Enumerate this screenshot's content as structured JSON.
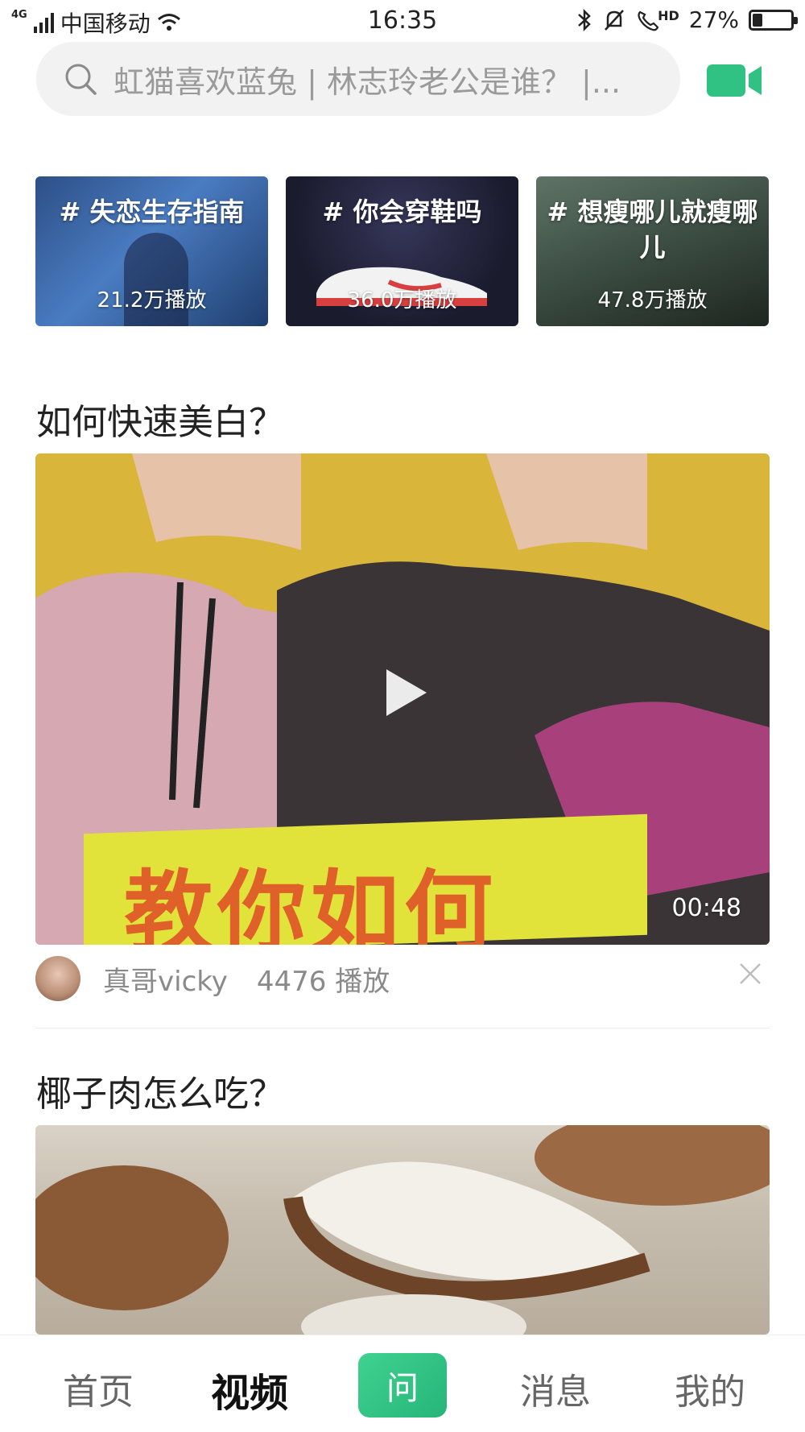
{
  "status_bar": {
    "network": "4G",
    "carrier": "中国移动",
    "time": "16:35",
    "hd": "HD",
    "battery": "27%",
    "battery_level": 0.27
  },
  "search": {
    "placeholder": "虹猫喜欢蓝兔 | 林志玲老公是谁？ |..."
  },
  "topics": [
    {
      "title": "# 失恋生存指南",
      "plays": "21.2万播放"
    },
    {
      "title": "# 你会穿鞋吗",
      "plays": "36.0万播放"
    },
    {
      "title": "# 想瘦哪儿就瘦哪儿",
      "plays": "47.8万播放"
    }
  ],
  "feed": [
    {
      "question": "如何快速美白？",
      "caption": "教你如何",
      "duration": "00:48",
      "author": "真哥vicky",
      "plays": "4476 播放"
    },
    {
      "question": "椰子肉怎么吃？"
    }
  ],
  "bottom_nav": {
    "home": "首页",
    "video": "视频",
    "ask": "问",
    "messages": "消息",
    "mine": "我的"
  },
  "colors": {
    "accent_green": "#2fc283",
    "video_bg": "#d9b53a"
  }
}
